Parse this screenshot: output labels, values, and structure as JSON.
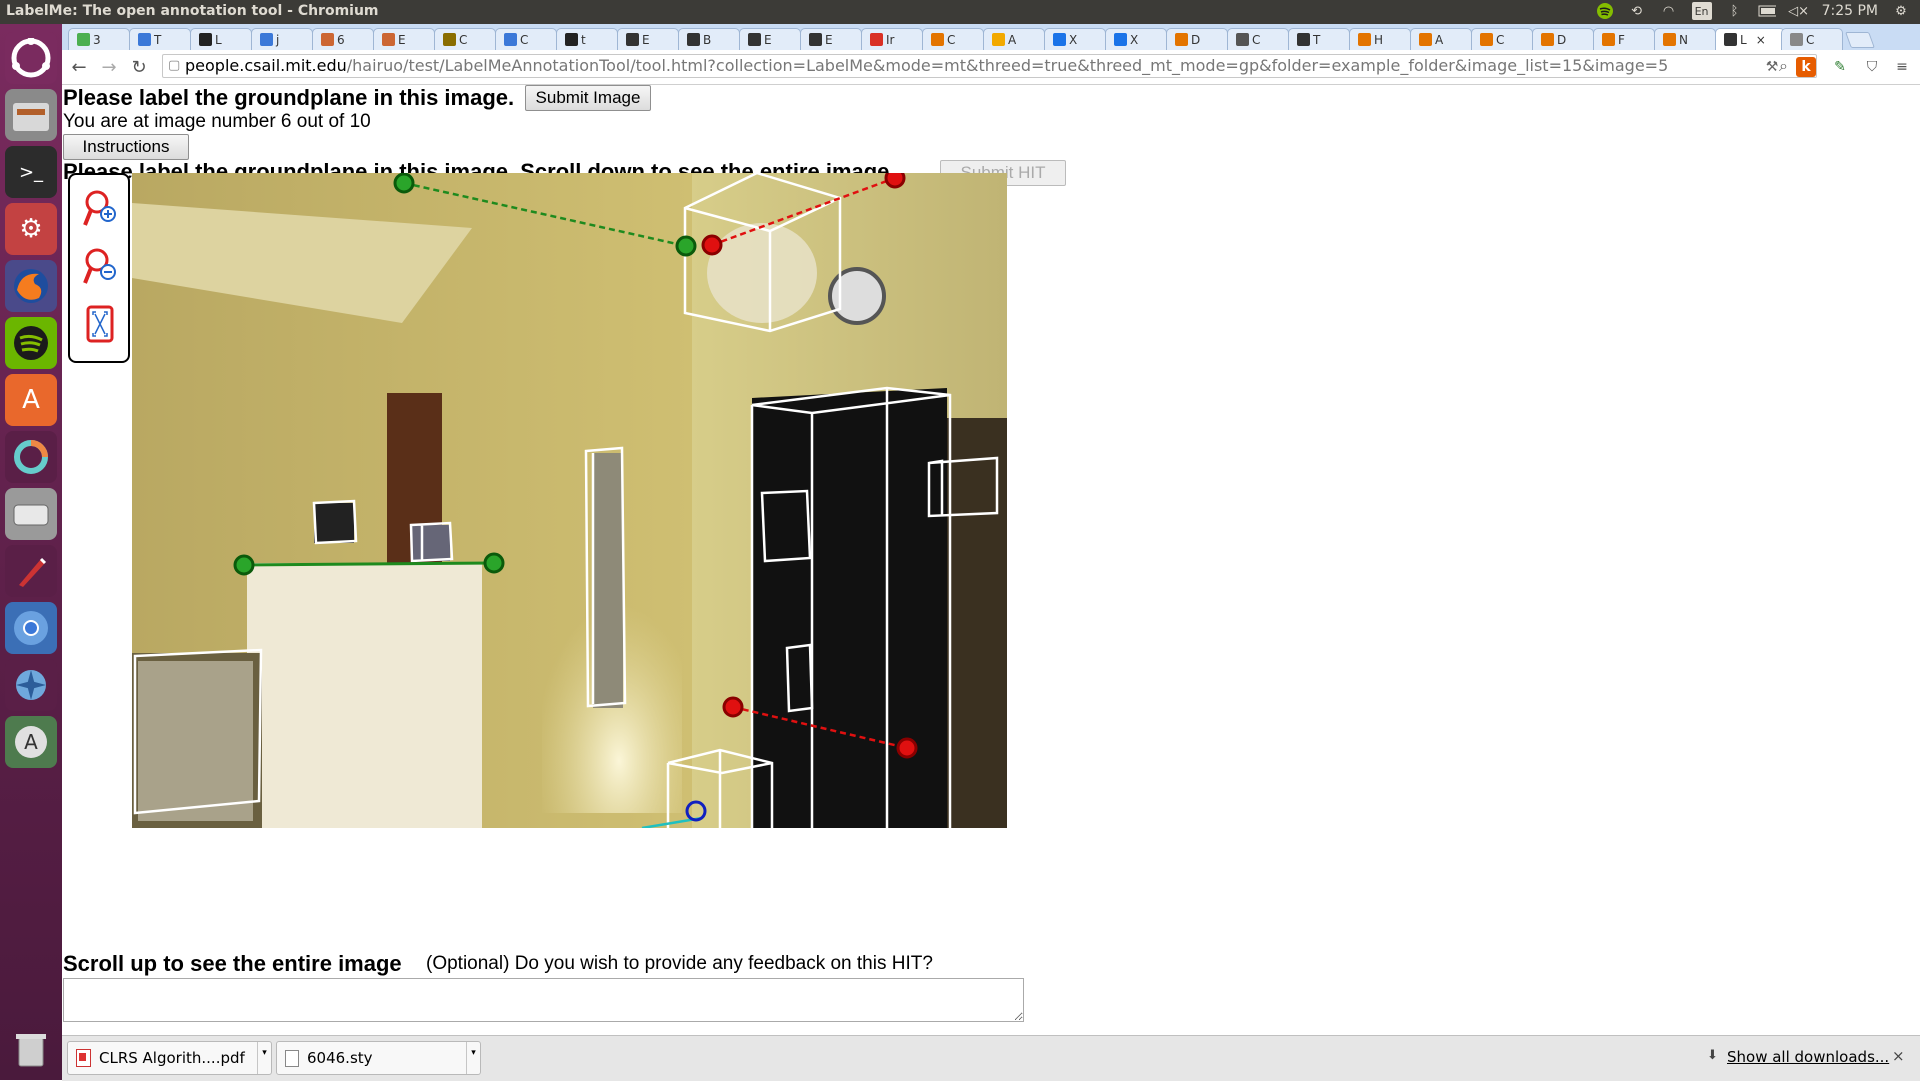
{
  "window_title": "LabelMe: The open annotation tool - Chromium",
  "clock": "7:25 PM",
  "tray": {
    "keyboard": "En"
  },
  "tabs": [
    {
      "label": "3",
      "color": "#4caf50"
    },
    {
      "label": "T",
      "color": "#3b78d8"
    },
    {
      "label": "L",
      "color": "#222222"
    },
    {
      "label": "j",
      "color": "#3b78d8"
    },
    {
      "label": "6",
      "color": "#cc6633"
    },
    {
      "label": "E",
      "color": "#cc6633"
    },
    {
      "label": "C",
      "color": "#8a6d00"
    },
    {
      "label": "C",
      "color": "#3b78d8"
    },
    {
      "label": "t",
      "color": "#222222"
    },
    {
      "label": "E",
      "color": "#333333"
    },
    {
      "label": "B",
      "color": "#333333"
    },
    {
      "label": "E",
      "color": "#333333"
    },
    {
      "label": "E",
      "color": "#333333"
    },
    {
      "label": "Ir",
      "color": "#d93025"
    },
    {
      "label": "C",
      "color": "#e37400"
    },
    {
      "label": "A",
      "color": "#f2a900"
    },
    {
      "label": "X",
      "color": "#1a73e8"
    },
    {
      "label": "X",
      "color": "#1a73e8"
    },
    {
      "label": "D",
      "color": "#e37400"
    },
    {
      "label": "C",
      "color": "#555555"
    },
    {
      "label": "T",
      "color": "#333333"
    },
    {
      "label": "H",
      "color": "#e37400"
    },
    {
      "label": "A",
      "color": "#e37400"
    },
    {
      "label": "C",
      "color": "#e37400"
    },
    {
      "label": "D",
      "color": "#e37400"
    },
    {
      "label": "F",
      "color": "#e37400"
    },
    {
      "label": "N",
      "color": "#e37400"
    },
    {
      "label": "L",
      "color": "#333333",
      "active": true
    },
    {
      "label": "C",
      "color": "#888888"
    }
  ],
  "address": {
    "host": "people.csail.mit.edu",
    "path": "/hairuo/test/LabelMeAnnotationTool/tool.html?collection=LabelMe&mode=mt&threed=true&threed_mt_mode=gp&folder=example_folder&image_list=15&image=5"
  },
  "page": {
    "heading": "Please label the groundplane in this image.",
    "submit_image_label": "Submit Image",
    "progress_text": "You are at image number 6 out of 10",
    "image_number": 6,
    "image_total": 10,
    "instructions_label": "Instructions",
    "heading2": "Please label the groundplane in this image. Scroll down to see the entire image.",
    "submit_hit_label": "Submit HIT",
    "scroll_up_text": "Scroll up to see the entire image",
    "feedback_prompt": "(Optional) Do you wish to provide any feedback on this HIT?",
    "feedback_value": ""
  },
  "downloads": {
    "items": [
      {
        "name": "CLRS Algorith....pdf"
      },
      {
        "name": "6046.sty"
      }
    ],
    "show_all": "Show all downloads..."
  },
  "colors": {
    "launcher": "#6b2556",
    "tabstrip": "#c9dcf4",
    "groundplane_line": "#1e8a1e",
    "vanishing_line": "#e01010"
  }
}
